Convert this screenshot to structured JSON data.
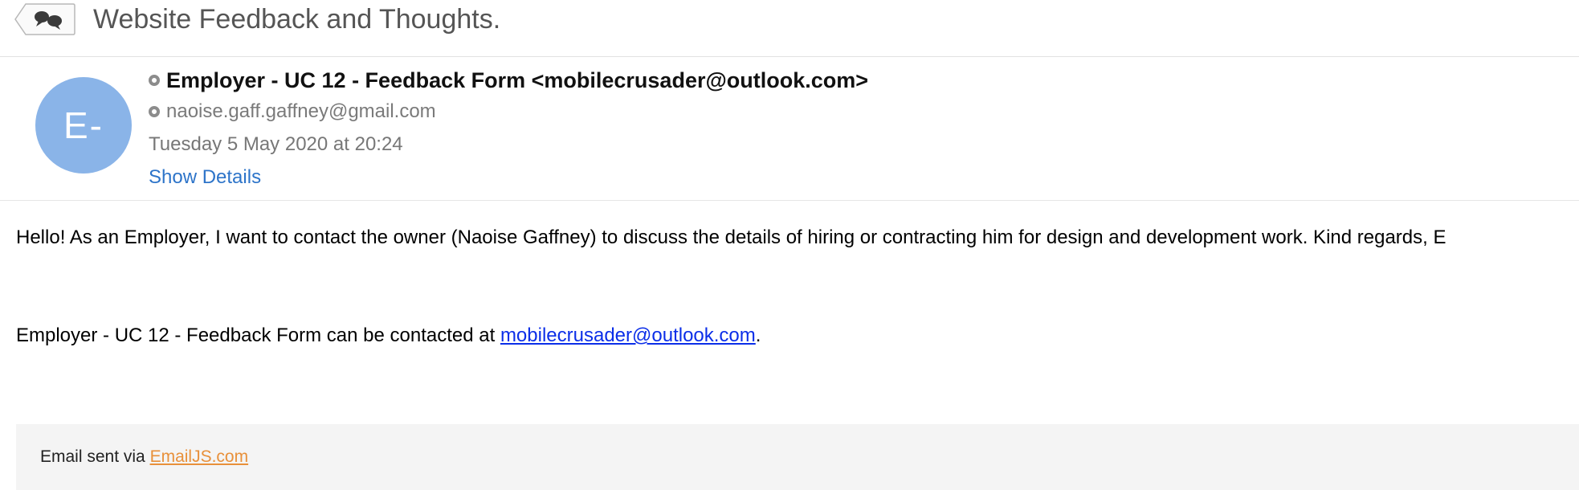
{
  "subject": {
    "title": "Website Feedback and Thoughts.",
    "thread_icon": "speech-bubbles-icon"
  },
  "header": {
    "avatar_initials": "E-",
    "avatar_color": "#8ab4e8",
    "from": "Employer - UC 12 - Feedback Form <mobilecrusader@outlook.com>",
    "to": "naoise.gaff.gaffney@gmail.com",
    "date": "Tuesday 5 May 2020 at 20:24",
    "show_details": "Show Details",
    "link_color": "#2d74c9"
  },
  "body": {
    "message": "Hello! As an Employer, I want to contact the owner (Naoise Gaffney) to discuss the details of hiring or contracting him for design and development work. Kind regards, E",
    "contact_prefix": "Employer - UC 12 - Feedback Form can be contacted at ",
    "contact_email": "mobilecrusader@outlook.com",
    "contact_suffix": "."
  },
  "footer": {
    "prefix": "Email sent via ",
    "link": "EmailJS.com",
    "link_color": "#e8903a"
  }
}
